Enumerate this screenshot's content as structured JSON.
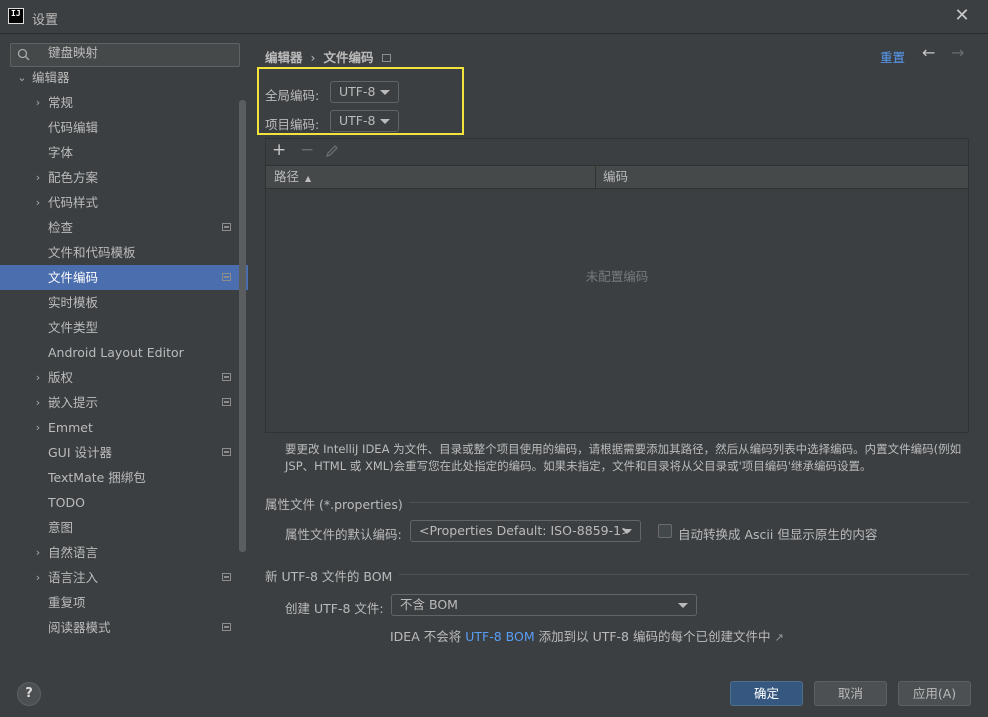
{
  "window": {
    "title": "设置",
    "logo_text": "IJ"
  },
  "search": {
    "placeholder": ""
  },
  "sidebar": {
    "items": [
      {
        "label": "键盘映射",
        "arrow": "",
        "indent": 1,
        "icon": false,
        "selected": false
      },
      {
        "label": "编辑器",
        "arrow": "⌄",
        "indent": 0,
        "icon": false,
        "selected": false
      },
      {
        "label": "常规",
        "arrow": "›",
        "indent": 1,
        "icon": false,
        "selected": false
      },
      {
        "label": "代码编辑",
        "arrow": "",
        "indent": 1,
        "icon": false,
        "selected": false
      },
      {
        "label": "字体",
        "arrow": "",
        "indent": 1,
        "icon": false,
        "selected": false
      },
      {
        "label": "配色方案",
        "arrow": "›",
        "indent": 1,
        "icon": false,
        "selected": false
      },
      {
        "label": "代码样式",
        "arrow": "›",
        "indent": 1,
        "icon": false,
        "selected": false
      },
      {
        "label": "检查",
        "arrow": "",
        "indent": 1,
        "icon": true,
        "selected": false
      },
      {
        "label": "文件和代码模板",
        "arrow": "",
        "indent": 1,
        "icon": false,
        "selected": false
      },
      {
        "label": "文件编码",
        "arrow": "",
        "indent": 1,
        "icon": true,
        "selected": true
      },
      {
        "label": "实时模板",
        "arrow": "",
        "indent": 1,
        "icon": false,
        "selected": false
      },
      {
        "label": "文件类型",
        "arrow": "",
        "indent": 1,
        "icon": false,
        "selected": false
      },
      {
        "label": "Android Layout Editor",
        "arrow": "",
        "indent": 1,
        "icon": false,
        "selected": false
      },
      {
        "label": "版权",
        "arrow": "›",
        "indent": 1,
        "icon": true,
        "selected": false
      },
      {
        "label": "嵌入提示",
        "arrow": "›",
        "indent": 1,
        "icon": true,
        "selected": false
      },
      {
        "label": "Emmet",
        "arrow": "›",
        "indent": 1,
        "icon": false,
        "selected": false
      },
      {
        "label": "GUI 设计器",
        "arrow": "",
        "indent": 1,
        "icon": true,
        "selected": false
      },
      {
        "label": "TextMate 捆绑包",
        "arrow": "",
        "indent": 1,
        "icon": false,
        "selected": false
      },
      {
        "label": "TODO",
        "arrow": "",
        "indent": 1,
        "icon": false,
        "selected": false
      },
      {
        "label": "意图",
        "arrow": "",
        "indent": 1,
        "icon": false,
        "selected": false
      },
      {
        "label": "自然语言",
        "arrow": "›",
        "indent": 1,
        "icon": false,
        "selected": false
      },
      {
        "label": "语言注入",
        "arrow": "›",
        "indent": 1,
        "icon": true,
        "selected": false
      },
      {
        "label": "重复项",
        "arrow": "",
        "indent": 1,
        "icon": false,
        "selected": false
      },
      {
        "label": "阅读器模式",
        "arrow": "",
        "indent": 1,
        "icon": true,
        "selected": false
      }
    ]
  },
  "breadcrumb": {
    "parent": "编辑器",
    "separator": "›",
    "current": "文件编码"
  },
  "header": {
    "reset_label": "重置",
    "back_icon": "arrow-left-icon",
    "forward_icon": "arrow-right-icon"
  },
  "encodings": {
    "global_label": "全局编码:",
    "global_value": "UTF-8",
    "project_label": "项目编码:",
    "project_value": "UTF-8"
  },
  "table": {
    "columns": [
      "路径",
      "编码"
    ],
    "sort_indicator": "▲",
    "empty_text": "未配置编码"
  },
  "description": "要更改 IntelliJ IDEA 为文件、目录或整个项目使用的编码，请根据需要添加其路径，然后从编码列表中选择编码。内置文件编码(例如JSP、HTML 或 XML)会重写您在此处指定的编码。如果未指定，文件和目录将从父目录或'项目编码'继承编码设置。",
  "properties": {
    "section_title": "属性文件 (*.properties)",
    "default_label": "属性文件的默认编码:",
    "default_value": "<Properties Default: ISO-8859-1>",
    "ascii_label": "自动转换成 Ascii 但显示原生的内容",
    "ascii_checked": false
  },
  "bom": {
    "section_title": "新 UTF-8 文件的 BOM",
    "create_label": "创建 UTF-8 文件:",
    "create_value": "不含 BOM",
    "info_prefix": "IDEA 不会将 ",
    "info_link": "UTF-8 BOM",
    "info_suffix": " 添加到以 UTF-8 编码的每个已创建文件中",
    "info_arrow": "↗"
  },
  "footer": {
    "help_label": "?",
    "ok_label": "确定",
    "cancel_label": "取消",
    "apply_label": "应用(A)"
  },
  "colors": {
    "accent": "#4b6eaf",
    "link": "#589df6",
    "highlight": "#f2e43a",
    "background": "#3c3f41"
  }
}
